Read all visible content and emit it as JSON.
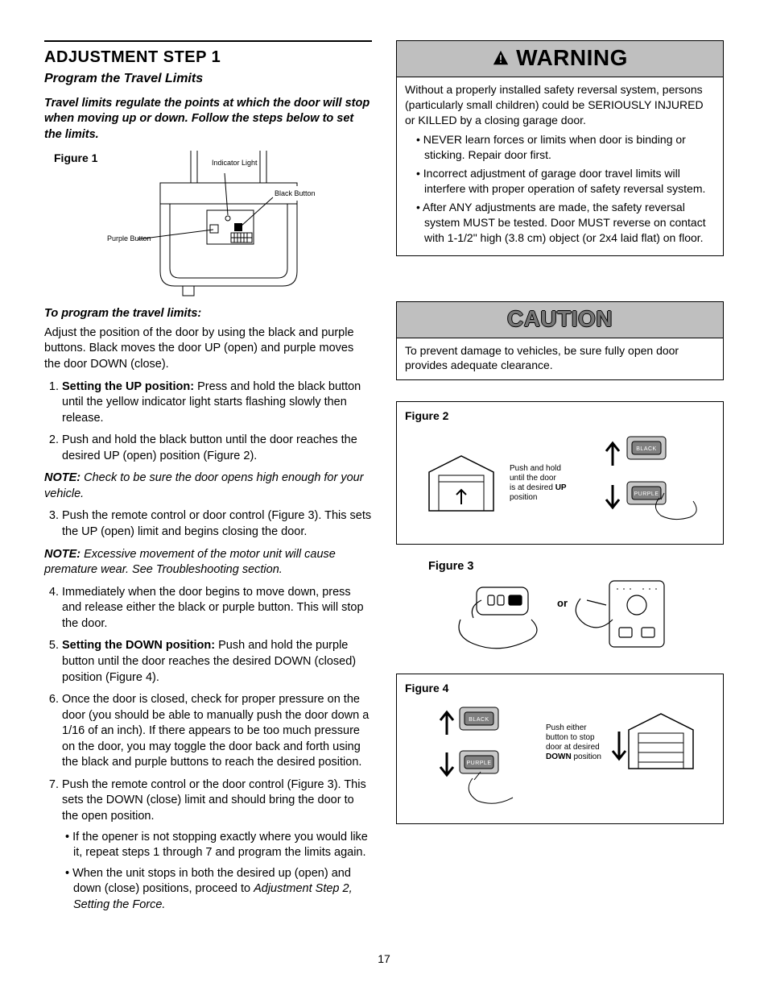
{
  "left": {
    "heading": "ADJUSTMENT STEP 1",
    "subtitle": "Program the Travel Limits",
    "intro": "Travel limits regulate the points at which the door will stop when moving up or down. Follow the steps below to set the limits.",
    "fig1_label": "Figure 1",
    "fig1_callouts": {
      "indicator": "Indicator Light",
      "black_btn": "Black Button",
      "purple_btn": "Purple Button"
    },
    "prog_head": "To program the travel limits:",
    "prog_intro": "Adjust the position of the door by using the black and purple buttons. Black moves the door UP (open) and purple moves the door DOWN (close).",
    "steps": {
      "s1_bold": "Setting the UP position:",
      "s1_rest": " Press and hold the black button until the yellow indicator light starts flashing slowly then release.",
      "s2": "Push and hold the black button until the door reaches the desired UP (open) position (Figure 2).",
      "note1_lead": "NOTE:",
      "note1_rest": " Check to be sure the door opens high enough for your vehicle.",
      "s3": "Push the remote control or door control (Figure 3). This sets the UP (open) limit and begins closing the door.",
      "note2_lead": "NOTE:",
      "note2_rest": " Excessive movement of the motor unit will cause premature wear. See Troubleshooting section.",
      "s4": "Immediately when the door begins to move down, press and release either the black or purple button. This will stop the door.",
      "s5_bold": "Setting the DOWN position:",
      "s5_rest": " Push and hold the purple button until the door reaches the desired DOWN (closed) position (Figure 4).",
      "s6": "Once the door is closed, check for proper pressure on the door (you should be able to manually push the door down a 1/16 of an inch). If there appears to be too much pressure on the door, you may toggle the door back and forth using the black and purple buttons to reach the desired position.",
      "s7": "Push the remote control or the door control (Figure 3). This sets the DOWN (close) limit and should bring the door to the open position.",
      "s7a": "If the opener is not stopping exactly where you would like it, repeat steps 1 through 7 and program the limits again.",
      "s7b_lead": "When the unit stops in both the desired up (open) and down (close) positions, proceed to ",
      "s7b_italic": "Adjustment Step 2, Setting the Force."
    }
  },
  "right": {
    "warning_title": "WARNING",
    "warning_lead": "Without a properly installed safety reversal system, persons (particularly small children) could be SERIOUSLY INJURED or KILLED by a closing garage door.",
    "warning_items": [
      "NEVER learn forces or limits when door is binding or sticking. Repair door first.",
      "Incorrect adjustment of garage door travel limits will interfere with proper operation of safety reversal system.",
      "After ANY adjustments are made, the safety reversal system MUST be tested. Door MUST reverse on contact with 1-1/2\" high (3.8 cm) object (or 2x4 laid flat) on floor."
    ],
    "caution_title": "CAUTION",
    "caution_body": "To prevent damage to vehicles, be sure fully open door provides adequate clearance.",
    "fig2_label": "Figure 2",
    "fig2_text_l1": "Push and hold",
    "fig2_text_l2": "until the door",
    "fig2_text_l3a": "is at desired ",
    "fig2_text_l3b": "UP",
    "fig2_text_l4": "position",
    "black_chip": "BLACK",
    "purple_chip": "PURPLE",
    "fig3_label": "Figure 3",
    "fig3_or": "or",
    "fig4_label": "Figure 4",
    "fig4_text_l1": "Push either",
    "fig4_text_l2": "button to stop",
    "fig4_text_l3": "door at desired",
    "fig4_text_l4a": "DOWN",
    "fig4_text_l4b": " position"
  },
  "page_num": "17"
}
